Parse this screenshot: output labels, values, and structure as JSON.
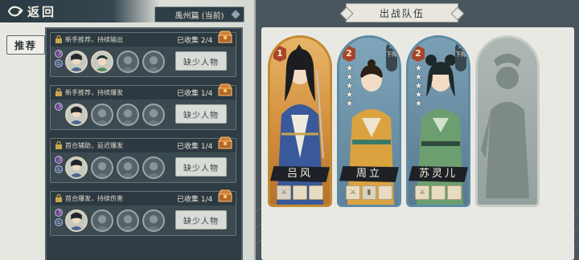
{
  "header": {
    "back_label": "返回",
    "chapter": "禹州篇 (当前)"
  },
  "sidebar": {
    "tab_recommend": "推荐"
  },
  "recommend_cards": [
    {
      "title": "新手推荐，持续输出",
      "collected": "已收集 2/4",
      "button": "缺少人物"
    },
    {
      "title": "新手推荐，持续爆发",
      "collected": "已收集 1/4",
      "button": "缺少人物"
    },
    {
      "title": "首合辅助，延迟爆发",
      "collected": "已收集 1/4",
      "button": "缺少人物"
    },
    {
      "title": "首合爆发，持续伤害",
      "collected": "已收集 1/4",
      "button": "缺少人物"
    }
  ],
  "team": {
    "title": "出战队伍",
    "heroes": [
      {
        "name": "吕风",
        "rank": "1",
        "stars": 0,
        "removable": false
      },
      {
        "name": "周立",
        "rank": "2",
        "stars": 5,
        "removable": true,
        "remove_label": "下阵"
      },
      {
        "name": "苏灵儿",
        "rank": "2",
        "stars": 5,
        "removable": true,
        "remove_label": "下阵"
      }
    ]
  },
  "colors": {
    "panel_dark": "#2f3c44",
    "accent_gold": "#c38a32",
    "accent_blue": "#5e8aa3",
    "rank_red": "#a6452d"
  },
  "icons": [
    "back-arrow-icon",
    "lock-icon",
    "chest-icon",
    "star-icon",
    "close-icon",
    "diamond-icon"
  ]
}
